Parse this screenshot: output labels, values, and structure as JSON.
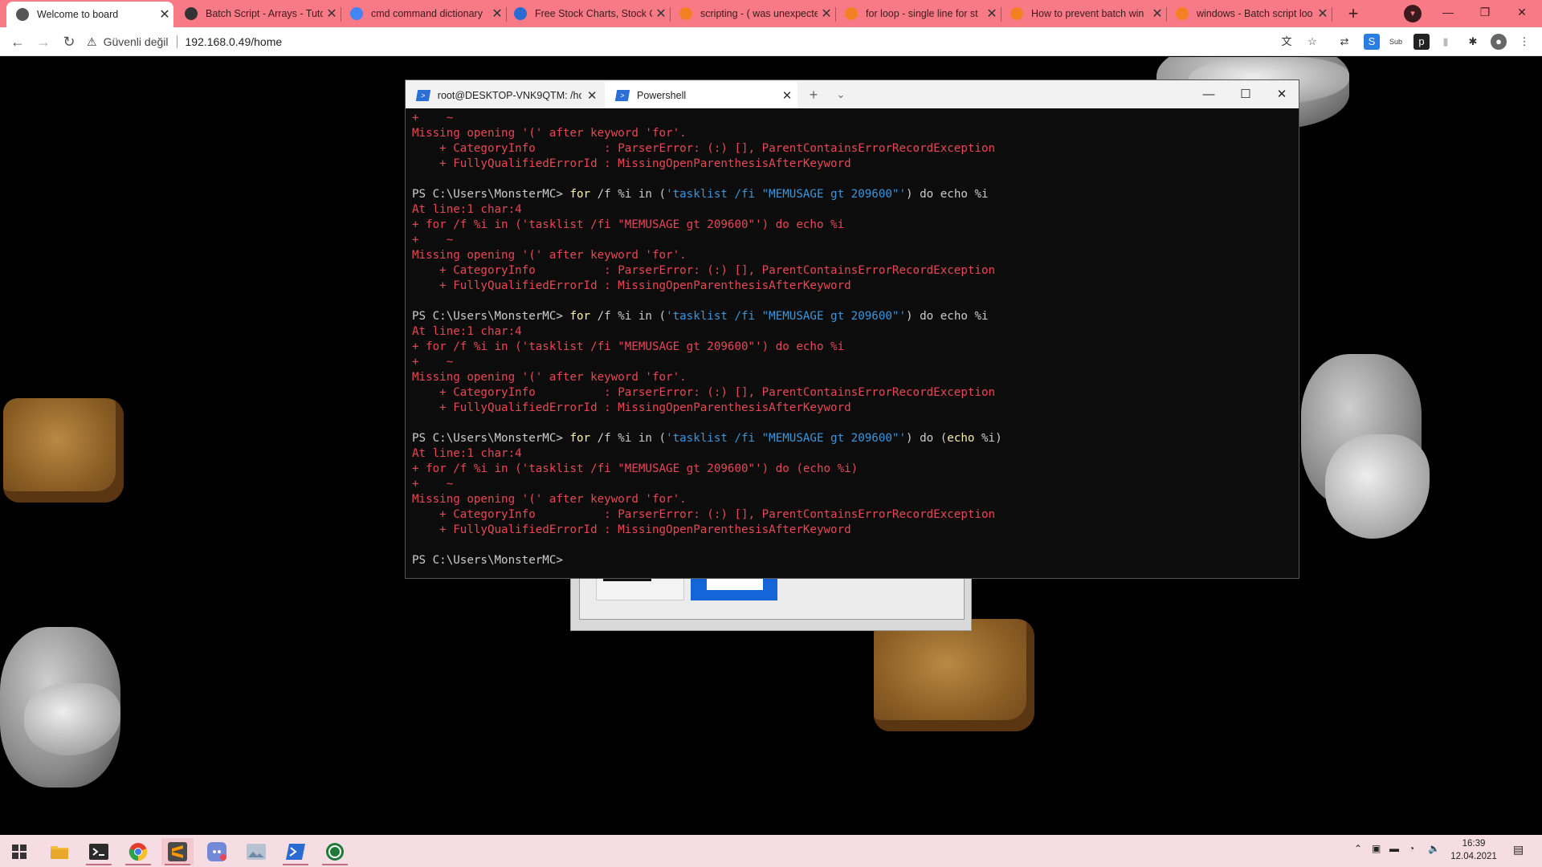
{
  "browser": {
    "tabs": [
      {
        "title": "Welcome to board",
        "icon": "globe-icon",
        "active": true
      },
      {
        "title": "Batch Script - Arrays - Tuto",
        "icon": "tutorialspoint-icon",
        "active": false
      },
      {
        "title": "cmd command dictionary",
        "icon": "google-icon",
        "active": false
      },
      {
        "title": "Free Stock Charts, Stock Q",
        "icon": "stockcharts-icon",
        "active": false
      },
      {
        "title": "scripting - ( was unexpecte",
        "icon": "stackoverflow-icon",
        "active": false
      },
      {
        "title": "for loop - single line for st",
        "icon": "stackoverflow-icon",
        "active": false
      },
      {
        "title": "How to prevent batch win",
        "icon": "stackoverflow-icon",
        "active": false
      },
      {
        "title": "windows - Batch script loo",
        "icon": "stackoverflow-icon",
        "active": false
      }
    ],
    "security_label": "Güvenli değil",
    "url": "192.168.0.49/home",
    "accent": "#f87a86"
  },
  "terminal": {
    "tabs": [
      {
        "label": "root@DESKTOP-VNK9QTM: /hc",
        "active": false
      },
      {
        "label": "Powershell",
        "active": true
      }
    ],
    "lines": [
      [
        {
          "t": "+    ~",
          "c": "err"
        }
      ],
      [
        {
          "t": "Missing opening '(' after keyword 'for'.",
          "c": "err"
        }
      ],
      [
        {
          "t": "    + CategoryInfo          : ParserError: (:) [], ParentContainsErrorRecordException",
          "c": "err"
        }
      ],
      [
        {
          "t": "    + FullyQualifiedErrorId : MissingOpenParenthesisAfterKeyword",
          "c": "err"
        }
      ],
      [],
      [
        {
          "t": "PS C:\\Users\\MonsterMC> ",
          "c": "pr"
        },
        {
          "t": "for",
          "c": "kw"
        },
        {
          "t": " /f %i in (",
          "c": "plain"
        },
        {
          "t": "'tasklist /fi \"MEMUSAGE gt 209600\"'",
          "c": "str"
        },
        {
          "t": ") do echo %i",
          "c": "plain"
        }
      ],
      [
        {
          "t": "At line:1 char:4",
          "c": "err"
        }
      ],
      [
        {
          "t": "+ for /f %i in ('tasklist /fi \"MEMUSAGE gt 209600\"') do echo %i",
          "c": "err"
        }
      ],
      [
        {
          "t": "+    ~",
          "c": "err"
        }
      ],
      [
        {
          "t": "Missing opening '(' after keyword 'for'.",
          "c": "err"
        }
      ],
      [
        {
          "t": "    + CategoryInfo          : ParserError: (:) [], ParentContainsErrorRecordException",
          "c": "err"
        }
      ],
      [
        {
          "t": "    + FullyQualifiedErrorId : MissingOpenParenthesisAfterKeyword",
          "c": "err"
        }
      ],
      [],
      [
        {
          "t": "PS C:\\Users\\MonsterMC> ",
          "c": "pr"
        },
        {
          "t": "for",
          "c": "kw"
        },
        {
          "t": " /f %i in (",
          "c": "plain"
        },
        {
          "t": "'tasklist /fi \"MEMUSAGE gt 209600\"'",
          "c": "str"
        },
        {
          "t": ") do echo %i",
          "c": "plain"
        }
      ],
      [
        {
          "t": "At line:1 char:4",
          "c": "err"
        }
      ],
      [
        {
          "t": "+ for /f %i in ('tasklist /fi \"MEMUSAGE gt 209600\"') do echo %i",
          "c": "err"
        }
      ],
      [
        {
          "t": "+    ~",
          "c": "err"
        }
      ],
      [
        {
          "t": "Missing opening '(' after keyword 'for'.",
          "c": "err"
        }
      ],
      [
        {
          "t": "    + CategoryInfo          : ParserError: (:) [], ParentContainsErrorRecordException",
          "c": "err"
        }
      ],
      [
        {
          "t": "    + FullyQualifiedErrorId : MissingOpenParenthesisAfterKeyword",
          "c": "err"
        }
      ],
      [],
      [
        {
          "t": "PS C:\\Users\\MonsterMC> ",
          "c": "pr"
        },
        {
          "t": "for",
          "c": "kw"
        },
        {
          "t": " /f %i in (",
          "c": "plain"
        },
        {
          "t": "'tasklist /fi \"MEMUSAGE gt 209600\"'",
          "c": "str"
        },
        {
          "t": ") do (",
          "c": "plain"
        },
        {
          "t": "echo",
          "c": "cmd"
        },
        {
          "t": " %i)",
          "c": "plain"
        }
      ],
      [
        {
          "t": "At line:1 char:4",
          "c": "err"
        }
      ],
      [
        {
          "t": "+ for /f %i in ('tasklist /fi \"MEMUSAGE gt 209600\"') do (echo %i)",
          "c": "err"
        }
      ],
      [
        {
          "t": "+    ~",
          "c": "err"
        }
      ],
      [
        {
          "t": "Missing opening '(' after keyword 'for'.",
          "c": "err"
        }
      ],
      [
        {
          "t": "    + CategoryInfo          : ParserError: (:) [], ParentContainsErrorRecordException",
          "c": "err"
        }
      ],
      [
        {
          "t": "    + FullyQualifiedErrorId : MissingOpenParenthesisAfterKeyword",
          "c": "err"
        }
      ],
      [],
      [
        {
          "t": "PS C:\\Users\\MonsterMC> ",
          "c": "pr"
        }
      ]
    ]
  },
  "taskbar": {
    "apps": [
      {
        "name": "start-button",
        "icon": "windows-icon"
      },
      {
        "name": "file-explorer",
        "icon": "folder-icon"
      },
      {
        "name": "terminal",
        "icon": "terminal-icon"
      },
      {
        "name": "chrome",
        "icon": "chrome-icon"
      },
      {
        "name": "sublime-text",
        "icon": "sublime-icon"
      },
      {
        "name": "discord",
        "icon": "discord-icon"
      },
      {
        "name": "photos",
        "icon": "photos-icon"
      },
      {
        "name": "powershell",
        "icon": "powershell-icon"
      },
      {
        "name": "hs-app",
        "icon": "hs-icon"
      }
    ],
    "time": "16:39",
    "date": "12.04.2021",
    "background": "#f5dde3"
  }
}
